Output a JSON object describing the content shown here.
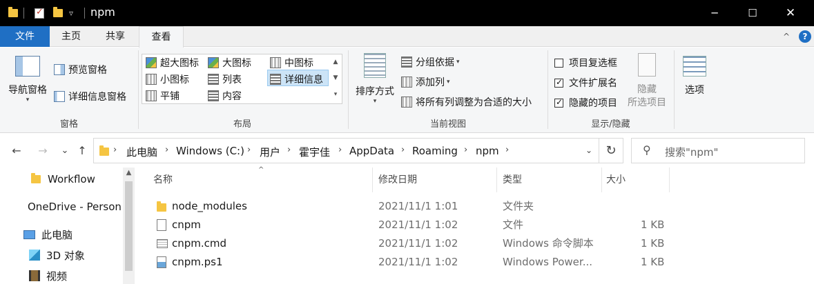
{
  "window": {
    "title": "npm",
    "quick_access_dropdown": "▿",
    "minimize": "─",
    "maximize": "☐",
    "close": "✕"
  },
  "ribbon_tabs": {
    "file": "文件",
    "home": "主页",
    "share": "共享",
    "view": "查看",
    "collapse": "^",
    "help": "?"
  },
  "ribbon": {
    "panes": {
      "label": "窗格",
      "nav_pane": "导航窗格",
      "preview_pane": "预览窗格",
      "details_pane": "详细信息窗格"
    },
    "layout": {
      "label": "布局",
      "extra_large_icons": "超大图标",
      "large_icons": "大图标",
      "medium_icons": "中图标",
      "small_icons": "小图标",
      "list": "列表",
      "details": "详细信息",
      "tiles": "平铺",
      "content": "内容"
    },
    "current_view": {
      "label": "当前视图",
      "sort_by": "排序方式",
      "group_by": "分组依据",
      "add_columns": "添加列",
      "size_all_columns": "将所有列调整为合适的大小"
    },
    "show_hide": {
      "label": "显示/隐藏",
      "item_checkboxes": "项目复选框",
      "item_checkboxes_checked": false,
      "file_name_extensions": "文件扩展名",
      "file_name_extensions_checked": true,
      "hidden_items": "隐藏的项目",
      "hidden_items_checked": true,
      "hide_selected_line1": "隐藏",
      "hide_selected_line2": "所选项目",
      "options": "选项"
    }
  },
  "address_bar": {
    "back": "←",
    "forward": "→",
    "recent": "⌄",
    "up": "↑",
    "crumbs": [
      "此电脑",
      "Windows (C:)",
      "用户",
      "霍宇佳",
      "AppData",
      "Roaming",
      "npm"
    ],
    "separator": "›",
    "refresh": "↻",
    "search_placeholder": "搜索\"npm\""
  },
  "nav_pane": {
    "items": [
      "Workflow",
      "OneDrive - Personal",
      "此电脑",
      "3D 对象",
      "视频"
    ]
  },
  "file_list": {
    "columns": {
      "name": "名称",
      "date": "修改日期",
      "type": "类型",
      "size": "大小"
    },
    "rows": [
      {
        "name": "node_modules",
        "date": "2021/11/1 1:01",
        "type": "文件夹",
        "size": "",
        "icon": "folder-icon"
      },
      {
        "name": "cnpm",
        "date": "2021/11/1 1:02",
        "type": "文件",
        "size": "1 KB",
        "icon": "file-icon"
      },
      {
        "name": "cnpm.cmd",
        "date": "2021/11/1 1:02",
        "type": "Windows 命令脚本",
        "size": "1 KB",
        "icon": "cmd-script-icon"
      },
      {
        "name": "cnpm.ps1",
        "date": "2021/11/1 1:02",
        "type": "Windows Power...",
        "size": "1 KB",
        "icon": "powershell-icon"
      }
    ]
  },
  "colors": {
    "file_tab": "#1f6fc4",
    "selection": "#cce4f7",
    "titlebar": "#000000",
    "folder": "#f5c542"
  }
}
